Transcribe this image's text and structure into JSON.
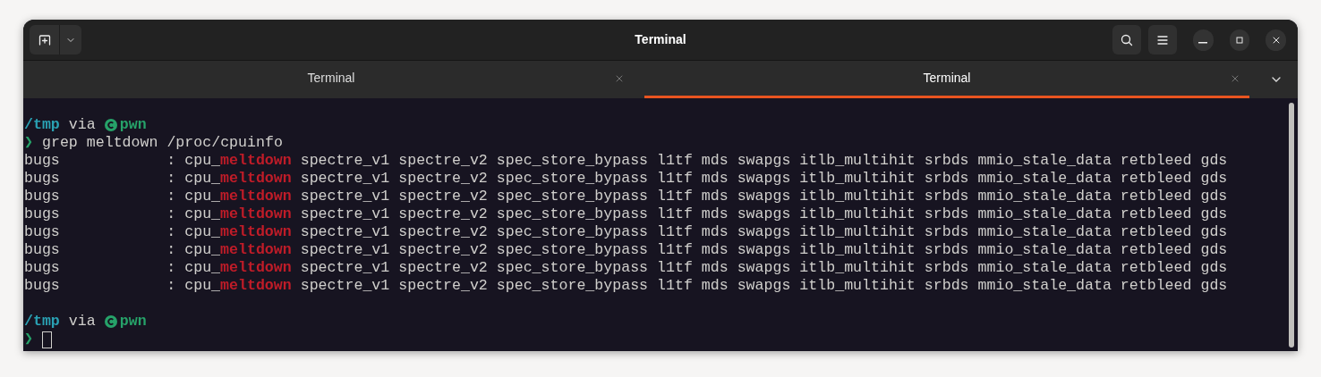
{
  "window": {
    "title": "Terminal"
  },
  "tabs": [
    {
      "label": "Terminal",
      "selected": false
    },
    {
      "label": "Terminal",
      "selected": true
    }
  ],
  "terminal": [
    {
      "kind": "prompt",
      "directory": "/tmp",
      "via": "via",
      "env": "pwn"
    },
    {
      "kind": "command",
      "symbol": "❯",
      "text": "grep meltdown /proc/cpuinfo"
    },
    {
      "kind": "output",
      "text": "bugs            : cpu_**meltdown** spectre_v1 spectre_v2 spec_store_bypass l1tf mds swapgs itlb_multihit srbds mmio_stale_data retbleed gds"
    },
    {
      "kind": "output",
      "text": "bugs            : cpu_**meltdown** spectre_v1 spectre_v2 spec_store_bypass l1tf mds swapgs itlb_multihit srbds mmio_stale_data retbleed gds"
    },
    {
      "kind": "output",
      "text": "bugs            : cpu_**meltdown** spectre_v1 spectre_v2 spec_store_bypass l1tf mds swapgs itlb_multihit srbds mmio_stale_data retbleed gds"
    },
    {
      "kind": "output",
      "text": "bugs            : cpu_**meltdown** spectre_v1 spectre_v2 spec_store_bypass l1tf mds swapgs itlb_multihit srbds mmio_stale_data retbleed gds"
    },
    {
      "kind": "output",
      "text": "bugs            : cpu_**meltdown** spectre_v1 spectre_v2 spec_store_bypass l1tf mds swapgs itlb_multihit srbds mmio_stale_data retbleed gds"
    },
    {
      "kind": "output",
      "text": "bugs            : cpu_**meltdown** spectre_v1 spectre_v2 spec_store_bypass l1tf mds swapgs itlb_multihit srbds mmio_stale_data retbleed gds"
    },
    {
      "kind": "output",
      "text": "bugs            : cpu_**meltdown** spectre_v1 spectre_v2 spec_store_bypass l1tf mds swapgs itlb_multihit srbds mmio_stale_data retbleed gds"
    },
    {
      "kind": "output",
      "text": "bugs            : cpu_**meltdown** spectre_v1 spectre_v2 spec_store_bypass l1tf mds swapgs itlb_multihit srbds mmio_stale_data retbleed gds"
    },
    {
      "kind": "blank"
    },
    {
      "kind": "prompt",
      "directory": "/tmp",
      "via": "via",
      "env": "pwn"
    },
    {
      "kind": "input",
      "symbol": "❯"
    }
  ]
}
